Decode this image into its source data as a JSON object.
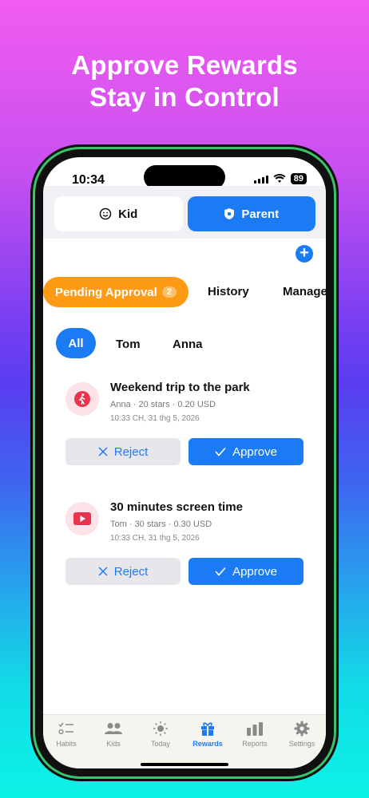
{
  "headline": {
    "line1": "Approve Rewards",
    "line2": "Stay in Control"
  },
  "status_bar": {
    "time": "10:34",
    "battery": "89"
  },
  "mode_toggle": {
    "kid_label": "Kid",
    "parent_label": "Parent",
    "selected": "Parent"
  },
  "tabs": {
    "pending_label": "Pending Approval",
    "pending_count": "2",
    "history_label": "History",
    "manage_label": "Manage"
  },
  "kid_filter": {
    "all_label": "All",
    "kids": [
      "Tom",
      "Anna"
    ],
    "selected": "All"
  },
  "requests": [
    {
      "title": "Weekend trip to the park",
      "meta": "Anna · 20 stars · 0.20 USD",
      "time": "10:33 CH, 31 thg 5, 2026",
      "icon": "walking-icon",
      "reject_label": "Reject",
      "approve_label": "Approve"
    },
    {
      "title": "30 minutes screen time",
      "meta": "Tom · 30 stars · 0.30 USD",
      "time": "10:33 CH, 31 thg 5, 2026",
      "icon": "play-screen-icon",
      "reject_label": "Reject",
      "approve_label": "Approve"
    }
  ],
  "bottom_nav": [
    {
      "label": "Habits",
      "icon": "checklist-icon"
    },
    {
      "label": "Kids",
      "icon": "people-icon"
    },
    {
      "label": "Today",
      "icon": "sun-icon"
    },
    {
      "label": "Rewards",
      "icon": "gift-icon",
      "active": true
    },
    {
      "label": "Reports",
      "icon": "bar-chart-icon"
    },
    {
      "label": "Settings",
      "icon": "gear-icon"
    }
  ],
  "colors": {
    "accent": "#1b7bf5",
    "pending": "#ff9a15"
  }
}
